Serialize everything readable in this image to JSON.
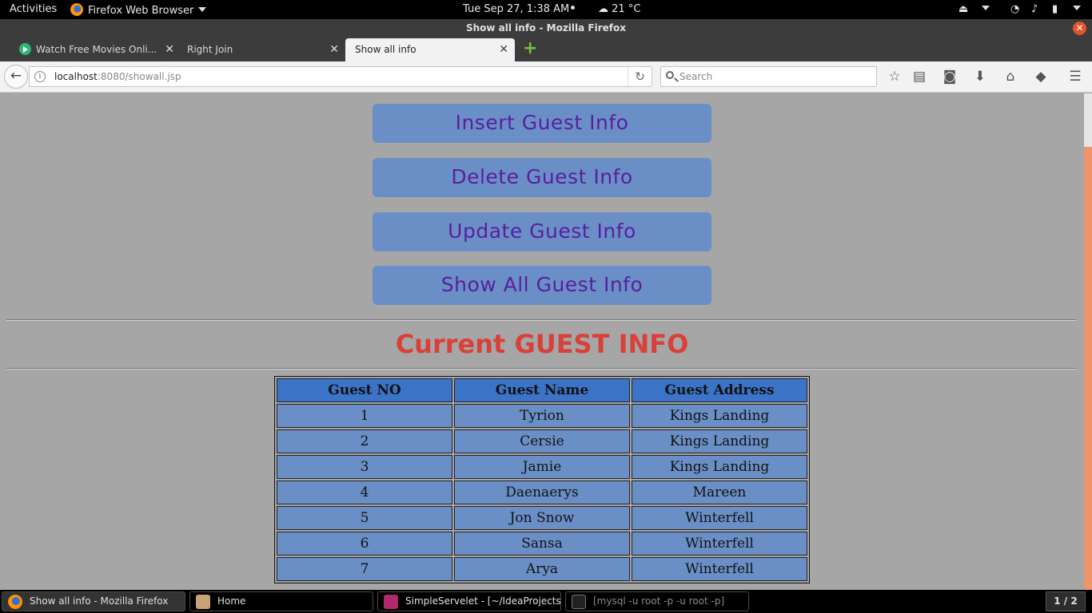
{
  "topbar": {
    "activities": "Activities",
    "app_menu": "Firefox Web Browser",
    "clock": "Tue Sep 27,  1:38 AM",
    "weather": "21 °C"
  },
  "window": {
    "title": "Show all info - Mozilla Firefox"
  },
  "tabs": [
    {
      "label": "Watch Free Movies Onli..."
    },
    {
      "label": "Right Join"
    },
    {
      "label": "Show all info"
    }
  ],
  "navbar": {
    "url_host": "localhost",
    "url_path": ":8080/showall.jsp",
    "search_placeholder": "Search"
  },
  "page": {
    "buttons": [
      "Insert Guest Info",
      "Delete Guest Info",
      "Update Guest Info",
      "Show All Guest Info"
    ],
    "heading": "Current GUEST INFO",
    "table": {
      "headers": [
        "Guest NO",
        "Guest Name",
        "Guest Address"
      ],
      "rows": [
        [
          "1",
          "Tyrion",
          "Kings Landing"
        ],
        [
          "2",
          "Cersie",
          "Kings Landing"
        ],
        [
          "3",
          "Jamie",
          "Kings Landing"
        ],
        [
          "4",
          "Daenaerys",
          "Mareen"
        ],
        [
          "5",
          "Jon Snow",
          "Winterfell"
        ],
        [
          "6",
          "Sansa",
          "Winterfell"
        ],
        [
          "7",
          "Arya",
          "Winterfell"
        ]
      ]
    }
  },
  "taskbar": {
    "items": [
      "Show all info - Mozilla Firefox",
      "Home",
      "SimpleServelet - [~/IdeaProjects/...",
      "[mysql -u root -p -u root -p]"
    ],
    "pager": "1 / 2"
  },
  "colors": {
    "page_bg": "#a6a6a6",
    "button_bg": "#6a8fc6",
    "button_text": "#5a1e9e",
    "heading": "#d9403a",
    "table_header_bg": "#3b74c6"
  }
}
